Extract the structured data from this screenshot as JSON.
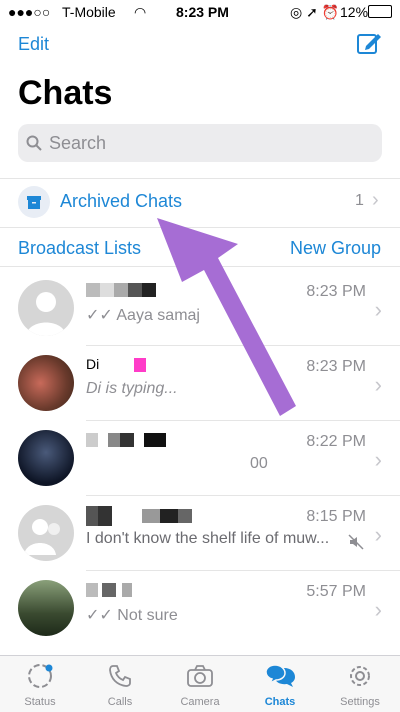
{
  "status_bar": {
    "carrier": "T-Mobile",
    "time": "8:23 PM",
    "battery": "12%"
  },
  "header": {
    "edit_label": "Edit",
    "title": "Chats",
    "compose_icon": "compose-icon"
  },
  "search": {
    "placeholder": "Search"
  },
  "archived": {
    "label": "Archived Chats",
    "count": "1"
  },
  "links": {
    "broadcast": "Broadcast Lists",
    "new_group": "New Group"
  },
  "chats": [
    {
      "time": "8:23 PM",
      "preview": "✓✓ Aaya samaj"
    },
    {
      "time": "8:23 PM",
      "preview": "Di is typing..."
    },
    {
      "time": "8:22 PM",
      "preview": "00"
    },
    {
      "time": "8:15 PM",
      "preview": "I don't know the shelf life of muw..."
    },
    {
      "time": "5:57 PM",
      "preview": "✓✓ Not sure"
    }
  ],
  "tabs": [
    {
      "label": "Status",
      "icon": "status-icon"
    },
    {
      "label": "Calls",
      "icon": "phone-icon"
    },
    {
      "label": "Camera",
      "icon": "camera-icon"
    },
    {
      "label": "Chats",
      "icon": "chat-bubbles-icon",
      "active": true
    },
    {
      "label": "Settings",
      "icon": "gear-icon"
    }
  ],
  "colors": {
    "accent": "#1d87d6",
    "annotation_arrow": "#a66dd4"
  }
}
